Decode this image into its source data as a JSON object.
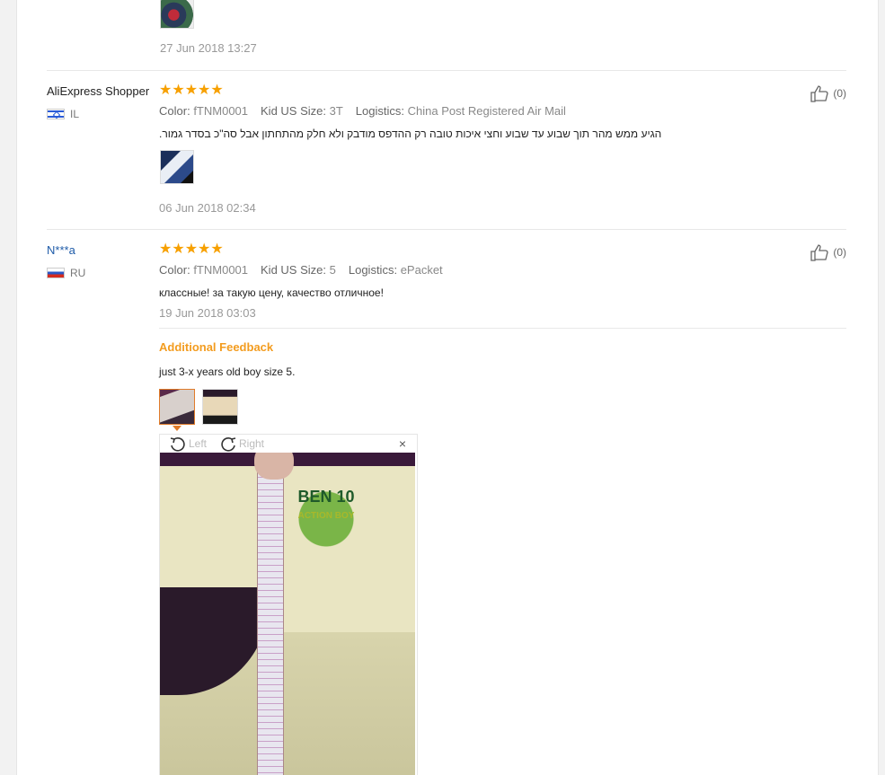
{
  "reviews": [
    {
      "date": "27 Jun 2018 13:27"
    },
    {
      "user": "AliExpress Shopper",
      "country": "IL",
      "stars": "★★★★★",
      "meta": {
        "color_label": "Color:",
        "color_value": "fTNM0001",
        "size_label": "Kid US Size:",
        "size_value": "3T",
        "logistics_label": "Logistics:",
        "logistics_value": "China Post Registered Air Mail"
      },
      "text": "הגיע ממש מהר תוך שבוע עד שבוע וחצי איכות טובה רק ההדפס מודבק ולא חלק מהתחתון אבל סה\"כ בסדר גמור.",
      "date": "06 Jun 2018 02:34",
      "likes": "(0)"
    },
    {
      "user": "N***a",
      "country": "RU",
      "stars": "★★★★★",
      "meta": {
        "color_label": "Color:",
        "color_value": "fTNM0001",
        "size_label": "Kid US Size:",
        "size_value": "5",
        "logistics_label": "Logistics:",
        "logistics_value": "ePacket"
      },
      "text": "классные! за такую цену, качество отличное!",
      "date": "19 Jun 2018 03:03",
      "likes": "(0)",
      "additional_title": "Additional Feedback",
      "additional_text": "just 3-x years old boy size 5."
    }
  ],
  "viewer": {
    "left_label": "Left",
    "right_label": "Right",
    "close": "×",
    "print_text": "BEN 10",
    "print_sub": "ACTION BOY"
  },
  "colors": {
    "star": "#f7a000",
    "accent": "#f39c1f",
    "link": "#1e5ba8"
  }
}
